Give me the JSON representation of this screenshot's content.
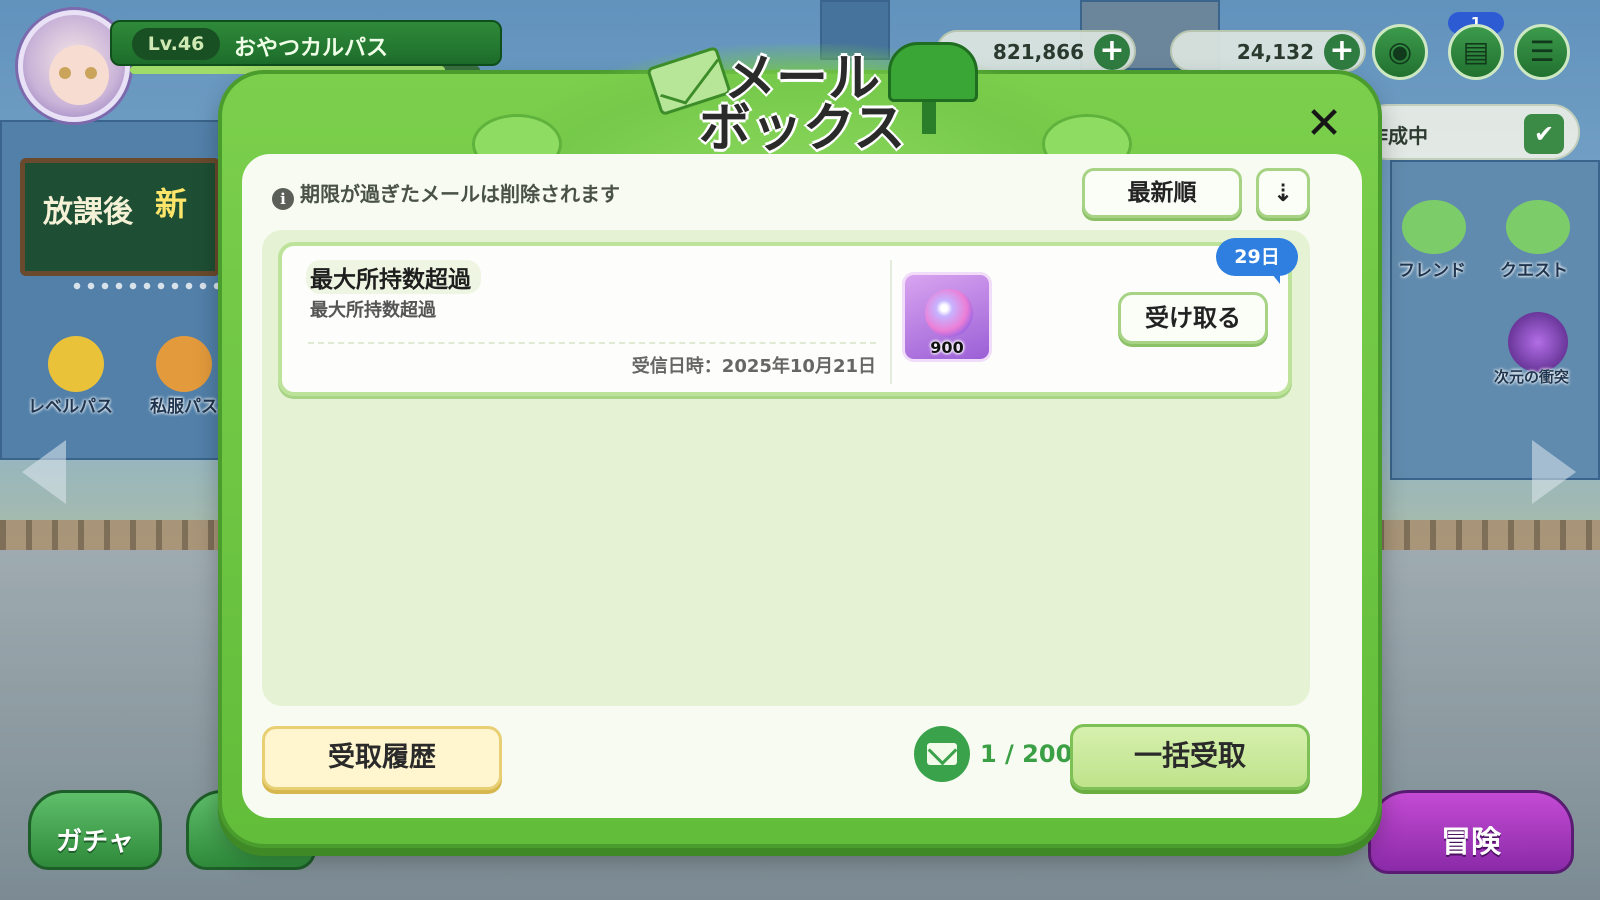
{
  "hud": {
    "level": "Lv.46",
    "player_name": "おやつカルパス",
    "exp_progress": 0.9,
    "currency_1": "821,866",
    "currency_2": "24,132",
    "plus": "+",
    "notification_badge": "1",
    "bell_icon": "bell-icon",
    "inventory_icon": "inventory-icon",
    "menu_icon": "menu-icon"
  },
  "side": {
    "board_title": "放課後",
    "board_title_2": "新",
    "level_pass": "レベルパス",
    "uniform_pass": "私服パス",
    "friend": "フレンド",
    "quest": "クエスト",
    "dimension_clash": "次元の衝突",
    "task_status": "作成中",
    "task_check": "✔",
    "gacha": "ガチャ",
    "adventure": "冒険"
  },
  "modal": {
    "title_line1": "メール",
    "title_line2": "ボックス",
    "close": "✕",
    "notice_icon": "i",
    "notice": "期限が過ぎたメールは削除されます",
    "sort_label": "最新順",
    "sort_dir_icon": "⇣",
    "mails": [
      {
        "title": "最大所持数超過",
        "subtitle": "最大所持数超過",
        "received": "受信日時：2025年10月21日",
        "expiry": "29日",
        "reward_count": "900",
        "receive_label": "受け取る"
      }
    ],
    "history_label": "受取履歴",
    "mail_count": "1 / 200",
    "bulk_label": "一括受取"
  },
  "colors": {
    "modal_green": "#6ec642",
    "panel_bg": "#f7fbf1",
    "badge_blue": "#2f7fe0",
    "history_yellow": "#fff6cf",
    "bulk_green": "#c9e89a"
  }
}
